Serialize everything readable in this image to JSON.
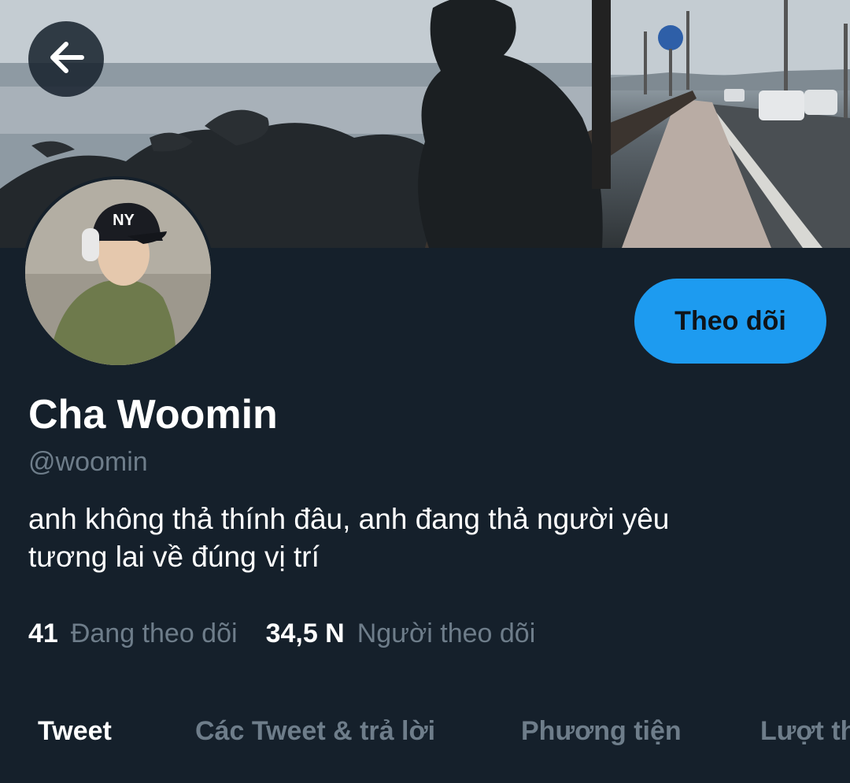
{
  "header": {
    "back_icon": "arrow-left-icon",
    "banner_image": "seaside-boardwalk-photo"
  },
  "profile": {
    "avatar": "profile-photo",
    "follow_label": "Theo dõi",
    "name": "Cha Woomin",
    "handle": "@woomin",
    "bio_line1": "anh không thả thính đâu, anh đang thả người yêu",
    "bio_line2": "tương lai về đúng vị trí"
  },
  "stats": {
    "following_count": "41",
    "following_label": "Đang theo dõi",
    "followers_count": "34,5 N",
    "followers_label": "Người theo dõi"
  },
  "tabs": [
    {
      "label": "Tweet"
    },
    {
      "label": "Các Tweet & trả lời"
    },
    {
      "label": "Phương tiện"
    },
    {
      "label": "Lượt thích"
    }
  ],
  "colors": {
    "background": "#15202b",
    "accent": "#1d9bf0",
    "muted_text": "#6e7d8a",
    "primary_text": "#ffffff"
  }
}
